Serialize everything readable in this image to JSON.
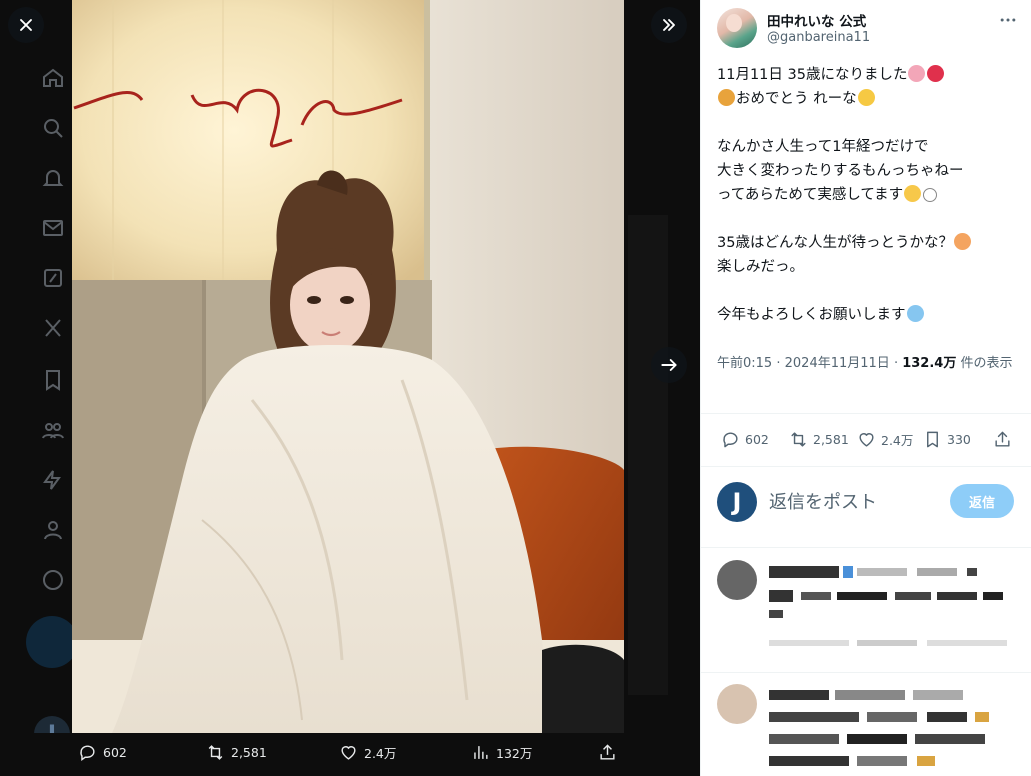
{
  "viewer": {
    "media_stats": {
      "replies": "602",
      "reposts": "2,581",
      "likes": "2.4万",
      "views": "132万"
    }
  },
  "tweet": {
    "display_name": "田中れいな 公式",
    "handle": "@ganbareina11",
    "lines": [
      "11月11日 35歳になりました",
      "おめでとう れーな",
      "",
      "なんかさ人生って1年経つだけで",
      "大きく変わったりするもんっちゃねー",
      "ってあらためて実感してます",
      "",
      "35歳はどんな人生が待っとうかな？",
      "楽しみだっ。",
      "",
      "今年もよろしくお願いします"
    ],
    "meta": {
      "time": "午前0:15",
      "dot": "·",
      "date": "2024年11月11日",
      "views_count": "132.4万",
      "views_label": "件の表示"
    },
    "stats": {
      "replies": "602",
      "reposts": "2,581",
      "likes": "2.4万",
      "bookmarks": "330"
    }
  },
  "reply": {
    "avatar_letter": "J",
    "placeholder": "返信をポスト",
    "button": "返信"
  },
  "colors": {
    "accent": "#1d9bf0",
    "reply_button_disabled": "#8ecdf8",
    "muted_text": "#536471",
    "viewer_background": "#0d0d0d"
  }
}
